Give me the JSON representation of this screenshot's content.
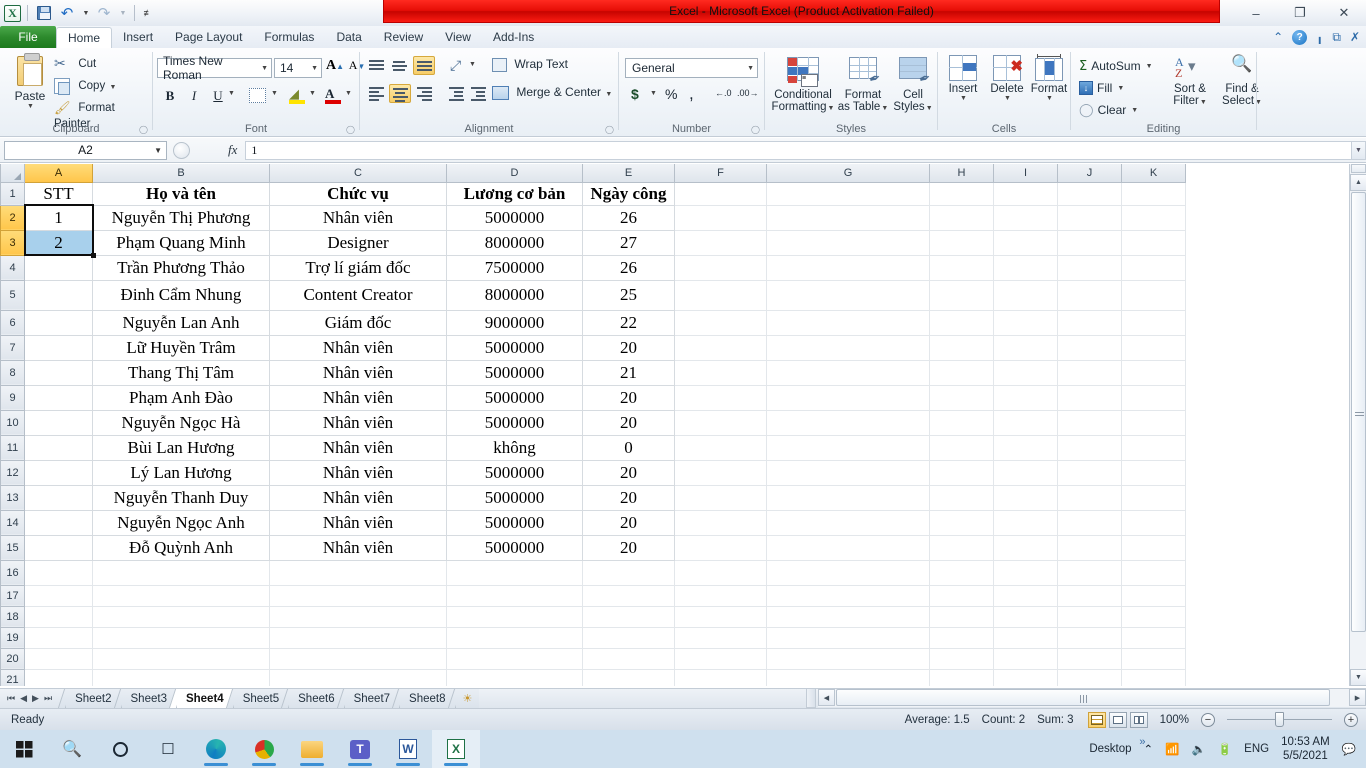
{
  "titlebar": {
    "title": "Excel  -  Microsoft Excel (Product Activation Failed)",
    "qat": {
      "save": "save-icon",
      "undo": "undo-icon",
      "redo": "redo-icon",
      "more": "customize-qat-icon"
    },
    "window_buttons": {
      "minimize": "–",
      "restore": "❐",
      "close": "✕"
    }
  },
  "ribbon": {
    "file_tab": "File",
    "tabs": [
      "Home",
      "Insert",
      "Page Layout",
      "Formulas",
      "Data",
      "Review",
      "View",
      "Add-Ins"
    ],
    "active_tab": "Home",
    "help": {
      "minimize_ribbon": "⌃",
      "help": "?"
    },
    "groups": {
      "clipboard": {
        "label": "Clipboard",
        "paste": "Paste",
        "cut": "Cut",
        "copy": "Copy",
        "format_painter": "Format Painter"
      },
      "font": {
        "label": "Font",
        "font_family": "Times New Roman",
        "font_size": "14",
        "grow": "A",
        "shrink": "A",
        "bold": "B",
        "italic": "I",
        "underline": "U",
        "borders": "borders-icon",
        "fill_color": "fill-color-icon",
        "font_color": "font-color-icon"
      },
      "alignment": {
        "label": "Alignment",
        "wrap_text": "Wrap Text",
        "merge_center": "Merge & Center",
        "orientation": "orientation-icon",
        "decrease_indent": "decrease-indent-icon",
        "increase_indent": "increase-indent-icon"
      },
      "number": {
        "label": "Number",
        "format": "General",
        "accounting": "$",
        "percent": "%",
        "comma": ",",
        "increase_decimal": ".00",
        "decrease_decimal": ".00"
      },
      "styles": {
        "label": "Styles",
        "conditional_formatting": "Conditional\nFormatting",
        "conditional_formatting_l1": "Conditional",
        "conditional_formatting_l2": "Formatting",
        "format_as_table_l1": "Format",
        "format_as_table_l2": "as Table",
        "cell_styles_l1": "Cell",
        "cell_styles_l2": "Styles"
      },
      "cells": {
        "label": "Cells",
        "insert": "Insert",
        "delete": "Delete",
        "format": "Format"
      },
      "editing": {
        "label": "Editing",
        "autosum": "AutoSum",
        "fill": "Fill",
        "clear": "Clear",
        "sort_filter_l1": "Sort &",
        "sort_filter_l2": "Filter",
        "find_select_l1": "Find &",
        "find_select_l2": "Select"
      }
    }
  },
  "formula_bar": {
    "name_box": "A2",
    "fx_label": "fx",
    "formula_value": "1"
  },
  "grid": {
    "columns": [
      "A",
      "B",
      "C",
      "D",
      "E",
      "F",
      "G",
      "H",
      "I",
      "J",
      "K"
    ],
    "selected_column": "A",
    "row_numbers": [
      1,
      2,
      3,
      4,
      5,
      6,
      7,
      8,
      9,
      10,
      11,
      12,
      13,
      14,
      15,
      16,
      17,
      18,
      19,
      20,
      21
    ],
    "selected_rows": [
      2,
      3
    ],
    "headers": {
      "A": "STT",
      "B": "Họ và tên",
      "C": "Chức vụ",
      "D": "Lương cơ bản",
      "E": "Ngày công"
    },
    "rows": [
      {
        "row": 2,
        "stt": "1",
        "name": "Nguyễn Thị Phương",
        "position": "Nhân viên",
        "salary": "5000000",
        "days": "26"
      },
      {
        "row": 3,
        "stt": "2",
        "name": "Phạm Quang Minh",
        "position": "Designer",
        "salary": "8000000",
        "days": "27"
      },
      {
        "row": 4,
        "stt": "",
        "name": "Trần Phương Thảo",
        "position": "Trợ lí giám đốc",
        "salary": "7500000",
        "days": "26"
      },
      {
        "row": 5,
        "stt": "",
        "name": "Đinh Cẩm Nhung",
        "position": "Content Creator",
        "salary": "8000000",
        "days": "25"
      },
      {
        "row": 6,
        "stt": "",
        "name": "Nguyễn Lan Anh",
        "position": "Giám đốc",
        "salary": "9000000",
        "days": "22"
      },
      {
        "row": 7,
        "stt": "",
        "name": "Lữ Huyền Trâm",
        "position": "Nhân viên",
        "salary": "5000000",
        "days": "20"
      },
      {
        "row": 8,
        "stt": "",
        "name": "Thang Thị Tâm",
        "position": "Nhân viên",
        "salary": "5000000",
        "days": "21"
      },
      {
        "row": 9,
        "stt": "",
        "name": "Phạm Anh Đào",
        "position": "Nhân viên",
        "salary": "5000000",
        "days": "20"
      },
      {
        "row": 10,
        "stt": "",
        "name": "Nguyễn Ngọc Hà",
        "position": "Nhân viên",
        "salary": "5000000",
        "days": "20"
      },
      {
        "row": 11,
        "stt": "",
        "name": "Bùi Lan Hương",
        "position": "Nhân viên",
        "salary": "không",
        "days": "0"
      },
      {
        "row": 12,
        "stt": "",
        "name": "Lý Lan Hương",
        "position": "Nhân viên",
        "salary": "5000000",
        "days": "20"
      },
      {
        "row": 13,
        "stt": "",
        "name": "Nguyễn Thanh Duy",
        "position": "Nhân viên",
        "salary": "5000000",
        "days": "20"
      },
      {
        "row": 14,
        "stt": "",
        "name": "Nguyễn Ngọc Anh",
        "position": "Nhân viên",
        "salary": "5000000",
        "days": "20"
      },
      {
        "row": 15,
        "stt": "",
        "name": "Đỗ Quỳnh Anh",
        "position": "Nhân viên",
        "salary": "5000000",
        "days": "20"
      }
    ]
  },
  "sheet_tabs": {
    "tabs": [
      "Sheet2",
      "Sheet3",
      "Sheet4",
      "Sheet5",
      "Sheet6",
      "Sheet7",
      "Sheet8"
    ],
    "active": "Sheet4",
    "insert_sheet": "insert-worksheet-icon",
    "nav": {
      "first": "⏮",
      "prev": "◀",
      "next": "▶",
      "last": "⏭"
    }
  },
  "status_bar": {
    "state": "Ready",
    "average": "Average: 1.5",
    "count": "Count: 2",
    "sum": "Sum: 3",
    "zoom": "100%",
    "views": {
      "normal": "normal-view-icon",
      "page_layout": "page-layout-view-icon",
      "page_break": "page-break-view-icon"
    },
    "zoom_out": "−",
    "zoom_in": "+"
  },
  "taskbar": {
    "start": "start-icon",
    "search": "search-icon",
    "cortana": "cortana-icon",
    "task_view": "task-view-icon",
    "apps": [
      "edge-icon",
      "chrome-beta-icon",
      "file-explorer-icon",
      "teams-icon",
      "word-icon",
      "excel-icon"
    ],
    "desktop": "Desktop",
    "overflow": "»",
    "chevron_up": "⌃",
    "network": "network-icon",
    "volume": "volume-icon",
    "battery": "battery-icon",
    "language": "ENG",
    "time": "10:53 AM",
    "date": "5/5/2021",
    "notifications": "notification-icon"
  }
}
